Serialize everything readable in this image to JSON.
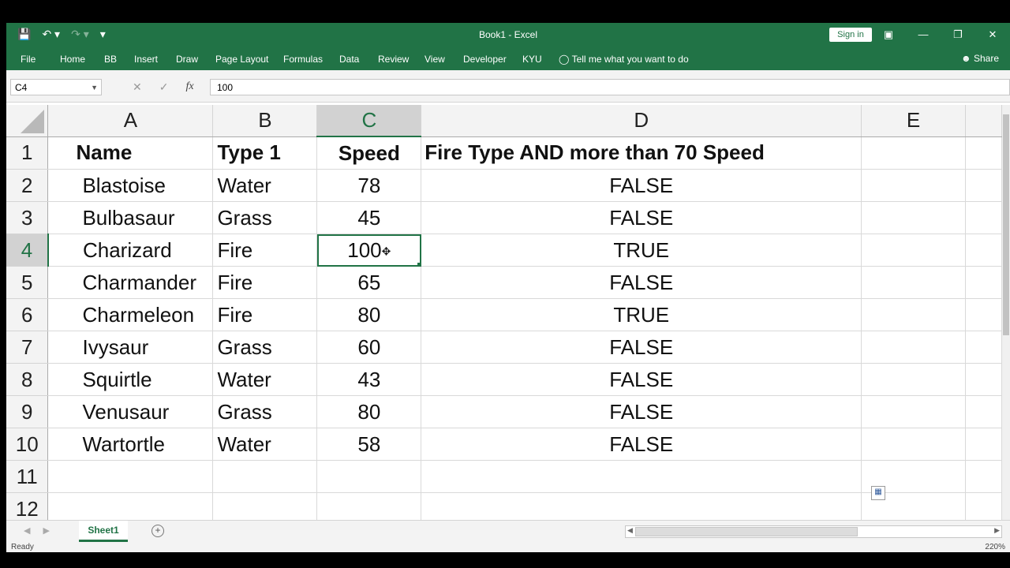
{
  "app": {
    "title": "Book1  -  Excel",
    "sign_in": "Sign in",
    "share": "Share"
  },
  "ribbon": {
    "tabs": [
      "File",
      "Home",
      "BB",
      "Insert",
      "Draw",
      "Page Layout",
      "Formulas",
      "Data",
      "Review",
      "View",
      "Developer",
      "KYU"
    ],
    "tell_me": "Tell me what you want to do"
  },
  "formula_bar": {
    "name_box": "C4",
    "value": "100"
  },
  "grid": {
    "columns": [
      "A",
      "B",
      "C",
      "D",
      "E"
    ],
    "selected_column": "C",
    "selected_row": "4",
    "rows": [
      {
        "num": "1",
        "cells": [
          "Name",
          "Type 1",
          "Speed",
          "Fire Type AND more than 70 Speed"
        ]
      },
      {
        "num": "2",
        "cells": [
          "Blastoise",
          "Water",
          "78",
          "FALSE"
        ]
      },
      {
        "num": "3",
        "cells": [
          "Bulbasaur",
          "Grass",
          "45",
          "FALSE"
        ]
      },
      {
        "num": "4",
        "cells": [
          "Charizard",
          "Fire",
          "100",
          "TRUE"
        ]
      },
      {
        "num": "5",
        "cells": [
          "Charmander",
          "Fire",
          "65",
          "FALSE"
        ]
      },
      {
        "num": "6",
        "cells": [
          "Charmeleon",
          "Fire",
          "80",
          "TRUE"
        ]
      },
      {
        "num": "7",
        "cells": [
          "Ivysaur",
          "Grass",
          "60",
          "FALSE"
        ]
      },
      {
        "num": "8",
        "cells": [
          "Squirtle",
          "Water",
          "43",
          "FALSE"
        ]
      },
      {
        "num": "9",
        "cells": [
          "Venusaur",
          "Grass",
          "80",
          "FALSE"
        ]
      },
      {
        "num": "10",
        "cells": [
          "Wartortle",
          "Water",
          "58",
          "FALSE"
        ]
      },
      {
        "num": "11",
        "cells": [
          "",
          "",
          "",
          ""
        ]
      },
      {
        "num": "12",
        "cells": [
          "",
          "",
          "",
          ""
        ]
      }
    ]
  },
  "sheets": [
    "Sheet1"
  ],
  "status": {
    "state": "Ready",
    "zoom": "220%"
  },
  "colors": {
    "accent": "#217346"
  }
}
